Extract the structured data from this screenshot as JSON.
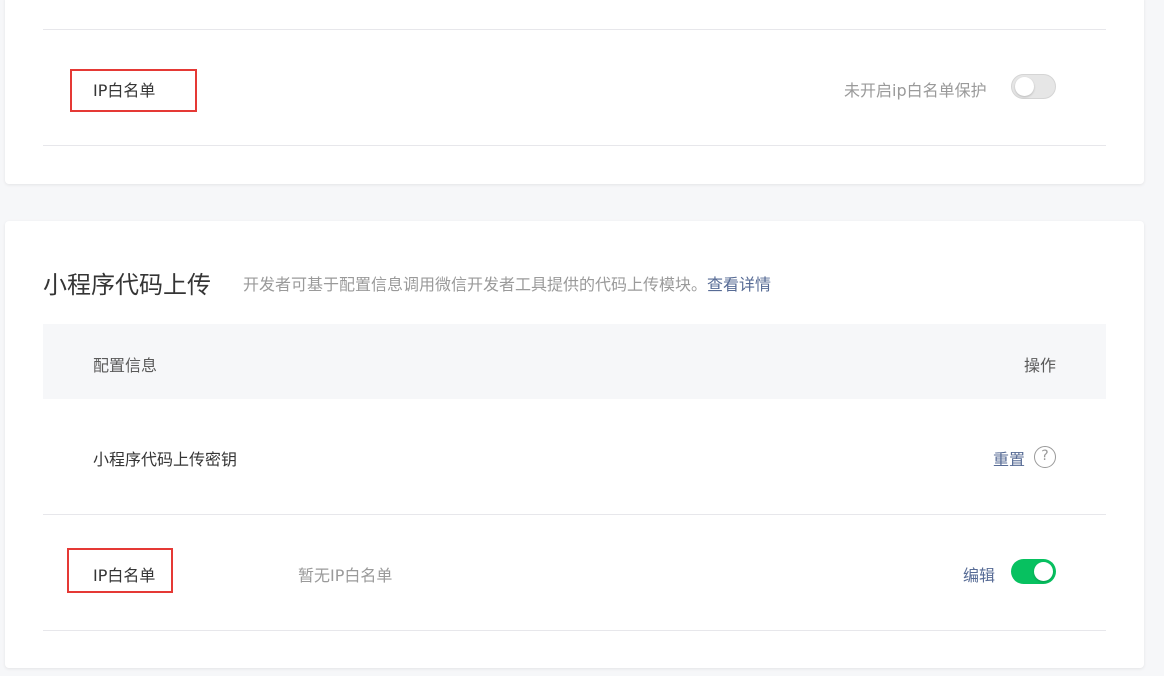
{
  "ip_whitelist_card": {
    "label": "IP白名单",
    "status_text": "未开启ip白名单保护",
    "toggle_on": false
  },
  "upload_section": {
    "title": "小程序代码上传",
    "description": "开发者可基于配置信息调用微信开发者工具提供的代码上传模块。",
    "details_link": "查看详情",
    "table": {
      "header_config": "配置信息",
      "header_action": "操作"
    },
    "secret_row": {
      "label": "小程序代码上传密钥",
      "action": "重置",
      "help_icon": "?"
    },
    "whitelist_row": {
      "label": "IP白名单",
      "value": "暂无IP白名单",
      "action": "编辑",
      "toggle_on": true
    }
  },
  "colors": {
    "toggle_on": "#07c160",
    "toggle_off": "#e6e6e6",
    "link": "#576b95",
    "highlight_box": "#e53935"
  }
}
